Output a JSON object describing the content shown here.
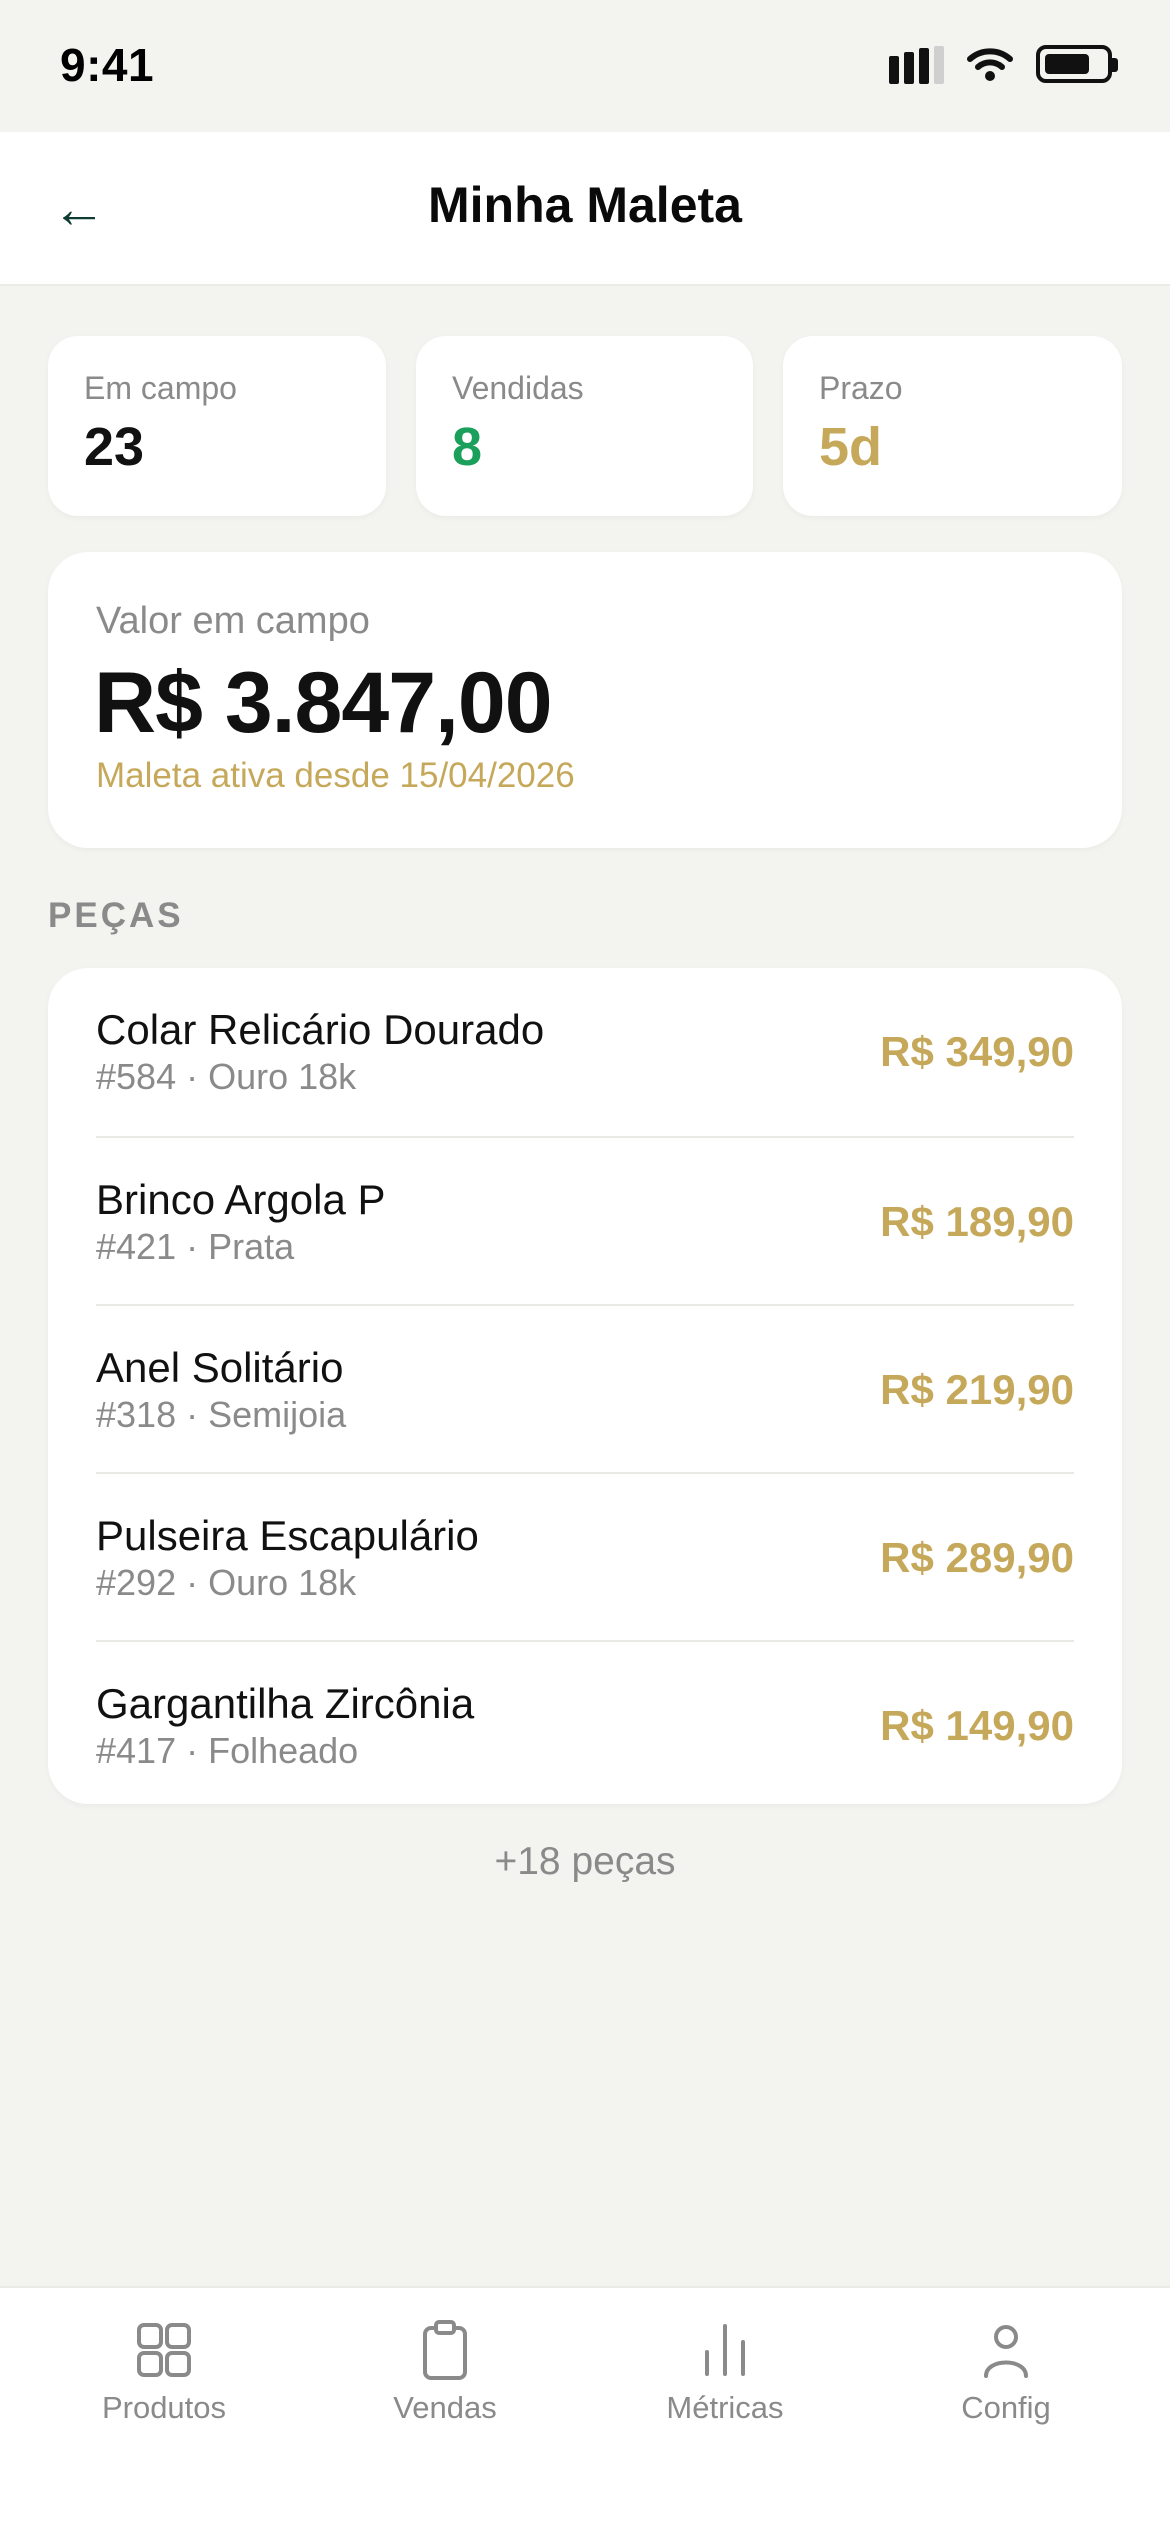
{
  "status_bar": {
    "time": "9:41"
  },
  "header": {
    "back_icon": "arrow-left-icon",
    "back_glyph": "←",
    "title": "Minha Maleta"
  },
  "stats": [
    {
      "label": "Em campo",
      "value": "23",
      "color": "#111111"
    },
    {
      "label": "Vendidas",
      "value": "8",
      "color": "#1aa05a"
    },
    {
      "label": "Prazo",
      "value": "5d",
      "color": "#c6a85a"
    }
  ],
  "summary": {
    "label": "Valor em campo",
    "value": "R$ 3.847,00",
    "subtitle": "Maleta ativa desde 15/04/2026"
  },
  "pieces": {
    "section_title": "PEÇAS",
    "items": [
      {
        "name": "Colar Relicário Dourado",
        "meta": "#584 · Ouro 18k",
        "price": "R$ 349,90"
      },
      {
        "name": "Brinco Argola P",
        "meta": "#421 · Prata",
        "price": "R$ 189,90"
      },
      {
        "name": "Anel Solitário",
        "meta": "#318 · Semijoia",
        "price": "R$ 219,90"
      },
      {
        "name": "Pulseira Escapulário",
        "meta": "#292 · Ouro 18k",
        "price": "R$ 289,90"
      },
      {
        "name": "Gargantilha Zircônia",
        "meta": "#417 · Folheado",
        "price": "R$ 149,90"
      }
    ],
    "more": "+18 peças"
  },
  "tabs": [
    {
      "label": "Produtos",
      "icon": "grid-icon"
    },
    {
      "label": "Vendas",
      "icon": "clipboard-icon"
    },
    {
      "label": "Métricas",
      "icon": "bar-chart-icon"
    },
    {
      "label": "Config",
      "icon": "user-icon"
    }
  ],
  "colors": {
    "accent_gold": "#c6a85a",
    "success_green": "#1aa05a",
    "back_arrow": "#0f3d33",
    "background": "#f3f3ef"
  }
}
